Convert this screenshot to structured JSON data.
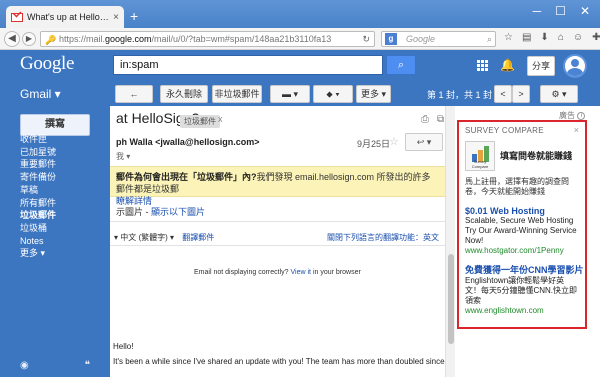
{
  "browser": {
    "tab_title": "What's up at HelloSign? - ",
    "tab_close": "×",
    "new_tab": "+",
    "url_prefix": "https://mail.",
    "url_host": "google.com",
    "url_path": "/mail/u/0/?tab=wm#spam/148aa21b3110fa13",
    "search_placeholder": "Google",
    "search_engine_letter": "g"
  },
  "gmail": {
    "logo": "Google",
    "search_value": "in:spam",
    "share_label": "分享",
    "gmail_label": "Gmail ▾"
  },
  "toolbar": {
    "back": "←",
    "delete_forever": "永久刪除",
    "not_spam": "非垃圾郵件",
    "folder": "▾",
    "labels": "▾",
    "more": "更多 ▾",
    "pager": "第 1 封，共 1 封",
    "prev": "<",
    "next": ">",
    "settings": "⚙ ▾"
  },
  "leftnav": {
    "compose": "撰寫",
    "items": [
      {
        "label": "收件匣"
      },
      {
        "label": "已加星號"
      },
      {
        "label": "重要郵件"
      },
      {
        "label": "寄件備份"
      },
      {
        "label": "草稿"
      },
      {
        "label": "所有郵件"
      },
      {
        "label": "垃圾郵件"
      },
      {
        "label": "垃圾桶"
      },
      {
        "label": "Notes"
      },
      {
        "label": "更多 ▾"
      }
    ]
  },
  "message": {
    "subject": "at HelloSign?",
    "tag": "垃圾郵件",
    "tag_close": "x",
    "sender": "ph Walla <jwalla@hellosign.com>",
    "date": "9月25日",
    "reply": "↩ ▾",
    "to_me": "我 ▾",
    "warning_bold": "郵件為何會出現在「垃圾郵件」內?",
    "warning_text": "我們發現 email.hellosign.com 所發出的許多郵件都是垃圾郵",
    "warning_link": "瞭解詳情",
    "images_text": "示圖片 - ",
    "images_link": "顯示以下圖片",
    "translate_lang": "▾  中文 (繁體字) ▾",
    "translate_link": "翻譯郵件",
    "translate_off": "關閉下列語言的翻譯功能：英文",
    "body_line": "Email not displaying correctly? ",
    "body_link": "View it",
    "body_line_end": " in your browser",
    "hello": "Hello!",
    "para": "It's been a while since I've shared an update with you! The team has more than doubled since"
  },
  "ads": {
    "label": "廣告",
    "info": "i",
    "brand": "SURVEY COMPARE",
    "close": "×",
    "survey_title": "填寫問卷就能賺錢",
    "survey_cap": "Survey Compare",
    "survey_desc": "馬上註冊，選擇有趣的調查問卷，今天就能開始賺錢",
    "ad1_head": "$0.01 Web Hosting",
    "ad1_text": "Scalable, Secure Web Hosting Try Our Award-Winning Service Now!",
    "ad1_url": "www.hostgator.com/1Penny",
    "ad2_head": "免費獲得一年份CNN學習影片",
    "ad2_text": "Englishtown讓你輕鬆學好英文！每天5分鐘聽懂CNN.快立即領索",
    "ad2_url": "www.englishtown.com"
  },
  "colors": {
    "gmail_blue": "#3c75c0",
    "ad_border": "#d8262b",
    "warning_bg": "#fbf3b7"
  }
}
